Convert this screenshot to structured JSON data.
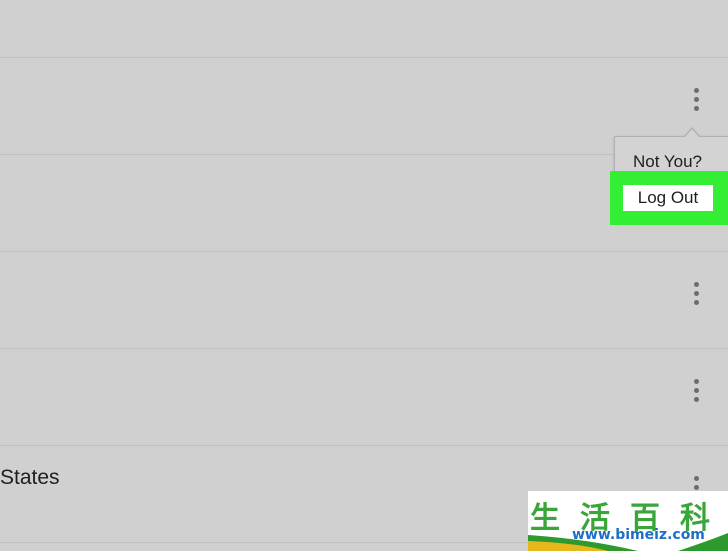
{
  "list": {
    "rows": [
      {
        "label": ""
      },
      {
        "label": ""
      },
      {
        "label": ""
      },
      {
        "label": ""
      },
      {
        "label": "States"
      }
    ]
  },
  "menu": {
    "not_you_label": "Not You?",
    "logout_label": "Log Out"
  },
  "watermark": {
    "chars": "生活百科",
    "url": "www.bimeiz.com"
  },
  "colors": {
    "background": "#d0d0d0",
    "highlight": "#33ee33",
    "kebab": "#6a6d73"
  },
  "icons": [
    "more-vertical-icon"
  ]
}
